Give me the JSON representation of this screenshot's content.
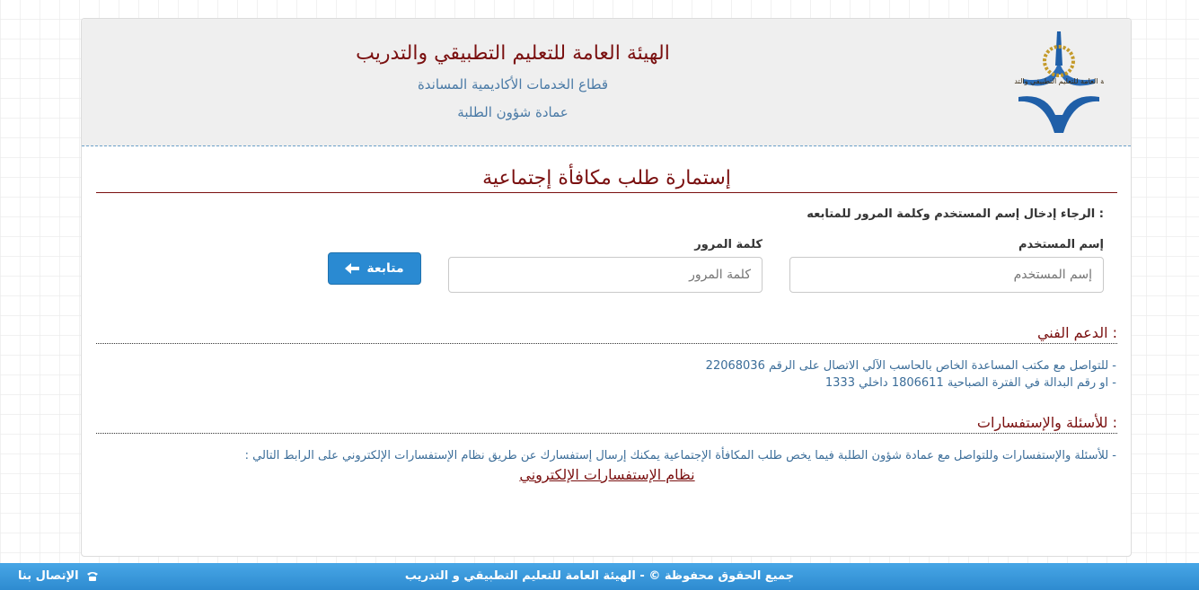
{
  "header": {
    "title": "الهيئة العامة للتعليم التطبيقي والتدريب",
    "subtitle1": "قطاع الخدمات الأكاديمية المساندة",
    "subtitle2": "عمادة شؤون الطلبة",
    "logo_text": "الهيئة العامة للتعليم التطبيقي والتدريب"
  },
  "form": {
    "title": "إستمارة طلب مكافأة إجتماعية",
    "instruction": "الرجاء إدخال إسم المستخدم وكلمة المرور للمتابعه :",
    "username_label": "إسم المستخدم",
    "username_placeholder": "إسم المستخدم",
    "password_label": "كلمة المرور",
    "password_placeholder": "كلمة المرور",
    "submit_label": "متابعة"
  },
  "support": {
    "title": "الدعم الفني :",
    "line1": "- للتواصل مع مكتب المساعدة الخاص بالحاسب الآلي الاتصال على الرقم 22068036",
    "line2": "- او رقم البدالة في الفترة الصباحية 1806611 داخلي 1333"
  },
  "faq": {
    "title": "للأسئلة والإستفسارات :",
    "line1": "- للأسئلة والإستفسارات وللتواصل مع عمادة شؤون الطلبة فيما يخص طلب المكافأة الإجتماعية يمكنك إرسال إستفسارك عن طريق نظام الإستفسارات الإلكتروني على الرابط التالي :",
    "link_label": "نظام الإستفسارات الإلكتروني"
  },
  "footer": {
    "copyright": "جميع الحقوق محفوظة © - الهيئة العامة للتعليم التطبيقي و التدريب",
    "contact_label": "الإتصال بنا"
  },
  "colors": {
    "accent": "#2a8ad2",
    "title_red": "#7a1010",
    "text_blue": "#3b6d99"
  }
}
